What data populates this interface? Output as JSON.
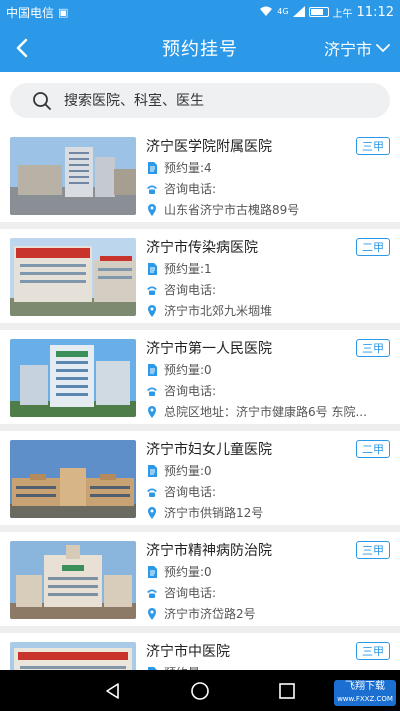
{
  "status_bar": {
    "carrier": "中国电信",
    "network": "4G",
    "time_prefix": "上午",
    "time": "11:12"
  },
  "header": {
    "title": "预约挂号",
    "city": "济宁市",
    "back_icon": "chevron-left-icon",
    "city_icon": "chevron-down-icon",
    "bg_color": "#2b98e8"
  },
  "search": {
    "placeholder": "搜索医院、科室、医生",
    "icon": "search-icon"
  },
  "labels": {
    "appointments": "预约量:",
    "phone": "咨询电话:"
  },
  "hospitals": [
    {
      "name": "济宁医学院附属医院",
      "grade": "三甲",
      "appointments": "4",
      "phone": "",
      "address": "山东省济宁市古槐路89号"
    },
    {
      "name": "济宁市传染病医院",
      "grade": "二甲",
      "appointments": "1",
      "phone": "",
      "address": "济宁市北郊九米堌堆"
    },
    {
      "name": "济宁市第一人民医院",
      "grade": "三甲",
      "appointments": "0",
      "phone": "",
      "address": "总院区地址：济宁市健康路6号 东院..."
    },
    {
      "name": "济宁市妇女儿童医院",
      "grade": "二甲",
      "appointments": "0",
      "phone": "",
      "address": "济宁市供销路12号"
    },
    {
      "name": "济宁市精神病防治院",
      "grade": "三甲",
      "appointments": "0",
      "phone": "",
      "address": "济宁市济岱路2号"
    },
    {
      "name": "济宁市中医院",
      "grade": "三甲",
      "appointments": "",
      "phone": "",
      "address": ""
    }
  ],
  "watermark": {
    "line1": "飞翔下载",
    "line2": "www.FXXZ.COM"
  }
}
